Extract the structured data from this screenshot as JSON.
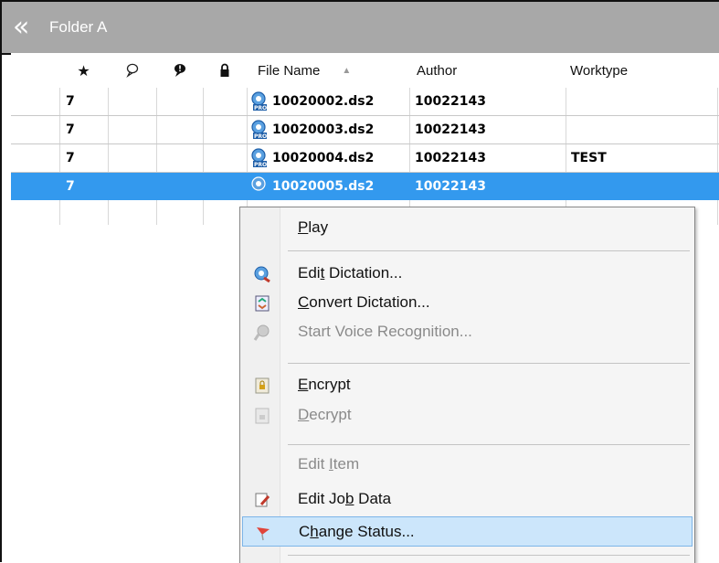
{
  "folder": {
    "chevron_glyph": "«",
    "title": "Folder A"
  },
  "columns": {
    "star": "★",
    "comment": "⚲",
    "note": "❢",
    "lock": "🔒",
    "filename": "File Name",
    "sort_glyph": "▲",
    "author": "Author",
    "worktype": "Worktype"
  },
  "rows": [
    {
      "priority": "7",
      "filename": "10020002.ds2",
      "author": "10022143",
      "worktype": ""
    },
    {
      "priority": "7",
      "filename": "10020003.ds2",
      "author": "10022143",
      "worktype": ""
    },
    {
      "priority": "7",
      "filename": "10020004.ds2",
      "author": "10022143",
      "worktype": "TEST"
    },
    {
      "priority": "7",
      "filename": "10020005.ds2",
      "author": "10022143",
      "worktype": ""
    }
  ],
  "context_menu": {
    "play": {
      "pre": "",
      "u": "P",
      "post": "lay"
    },
    "edit_dictation": {
      "pre": "Edi",
      "u": "t",
      "post": " Dictation..."
    },
    "convert_dictation": {
      "pre": "",
      "u": "C",
      "post": "onvert Dictation..."
    },
    "start_voice": {
      "pre": "Start Voice Reco",
      "u": "g",
      "post": "nition..."
    },
    "encrypt": {
      "pre": "",
      "u": "E",
      "post": "ncrypt"
    },
    "decrypt": {
      "pre": "",
      "u": "D",
      "post": "ecrypt"
    },
    "edit_item": {
      "pre": "Edit ",
      "u": "I",
      "post": "tem"
    },
    "edit_job": {
      "pre": "Edit Jo",
      "u": "b",
      "post": " Data"
    },
    "change_status": {
      "pre": "C",
      "u": "h",
      "post": "ange Status..."
    }
  },
  "colors": {
    "selection": "#3399ee",
    "menu_highlight": "#cce6fb",
    "folder_bar": "#a8a8a8"
  }
}
